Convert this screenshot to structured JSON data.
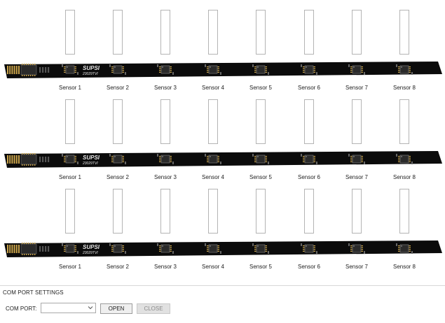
{
  "banks": [
    {
      "board": {
        "logo": "SUPSI",
        "code": "23029TVI"
      },
      "sensors": [
        {
          "label": "Sensor 1"
        },
        {
          "label": "Sensor 2"
        },
        {
          "label": "Sensor 3"
        },
        {
          "label": "Sensor 4"
        },
        {
          "label": "Sensor 5"
        },
        {
          "label": "Sensor 6"
        },
        {
          "label": "Sensor 7"
        },
        {
          "label": "Sensor 8"
        }
      ]
    },
    {
      "board": {
        "logo": "SUPSI",
        "code": "23029TVI"
      },
      "sensors": [
        {
          "label": "Sensor 1"
        },
        {
          "label": "Sensor 2"
        },
        {
          "label": "Sensor 3"
        },
        {
          "label": "Sensor 4"
        },
        {
          "label": "Sensor 5"
        },
        {
          "label": "Sensor 6"
        },
        {
          "label": "Sensor 7"
        },
        {
          "label": "Sensor 8"
        }
      ]
    },
    {
      "board": {
        "logo": "SUPSI",
        "code": "23029TVI"
      },
      "sensors": [
        {
          "label": "Sensor 1"
        },
        {
          "label": "Sensor 2"
        },
        {
          "label": "Sensor 3"
        },
        {
          "label": "Sensor 4"
        },
        {
          "label": "Sensor 5"
        },
        {
          "label": "Sensor 6"
        },
        {
          "label": "Sensor 7"
        },
        {
          "label": "Sensor 8"
        }
      ]
    }
  ],
  "com_settings": {
    "title": "COM PORT SETTINGS",
    "port_label": "COM PORT:",
    "port_value": "",
    "open_label": "OPEN",
    "close_label": "CLOSE"
  },
  "colors": {
    "pcb": "#0b0b0b",
    "chip": "#2a2a2a",
    "pad": "#c8a24a",
    "silk": "#e6e6e6",
    "bar_border": "#b4b4b4"
  }
}
